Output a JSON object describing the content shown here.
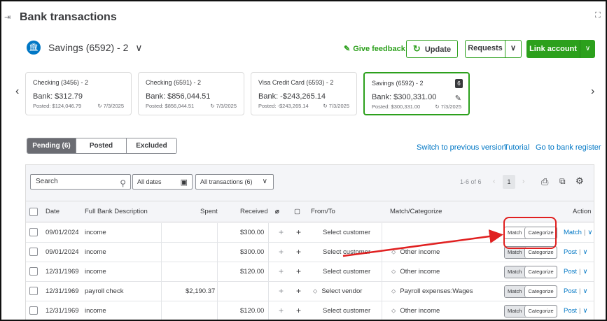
{
  "page": {
    "title": "Bank transactions"
  },
  "account": {
    "title": "Savings (6592) - 2",
    "chevron": "∨"
  },
  "header_actions": {
    "feedback_label": "Give feedback",
    "update_label": "Update",
    "requests_label": "Requests",
    "link_account_label": "Link account"
  },
  "cards": [
    {
      "name": "Checking (3456) - 2",
      "bank": "Bank: $312.79",
      "posted": "Posted: $124,046.79",
      "date": "7/3/2025",
      "selected": false
    },
    {
      "name": "Checking (6591) - 2",
      "bank": "Bank: $856,044.51",
      "posted": "Posted: $856,044.51",
      "date": "7/3/2025",
      "selected": false
    },
    {
      "name": "Visa Credit Card (6593) - 2",
      "bank": "Bank: -$243,265.14",
      "posted": "Posted: -$243,265.14",
      "date": "7/3/2025",
      "selected": false
    },
    {
      "name": "Savings (6592) - 2",
      "bank": "Bank: $300,331.00",
      "posted": "Posted: $300,331.00",
      "date": "7/3/2025",
      "selected": true,
      "badge": "6"
    }
  ],
  "tabs": {
    "pending": "Pending (6)",
    "posted": "Posted",
    "excluded": "Excluded"
  },
  "links": {
    "switch": "Switch to previous version",
    "tutorial": "Tutorial",
    "register": "Go to bank register"
  },
  "filters": {
    "search_placeholder": "Search",
    "dates": "All dates",
    "transactions": "All transactions (6)"
  },
  "pager": {
    "range": "1-6 of 6",
    "page": "1"
  },
  "table": {
    "headers": {
      "date": "Date",
      "desc": "Full Bank Description",
      "spent": "Spent",
      "received": "Received",
      "from_to": "From/To",
      "match": "Match/Categorize",
      "action": "Action"
    },
    "rows": [
      {
        "date": "09/01/2024",
        "desc": "income",
        "spent": "",
        "received": "$300.00",
        "from_to": "Select customer",
        "match": "",
        "action": "Match"
      },
      {
        "date": "09/01/2024",
        "desc": "income",
        "spent": "",
        "received": "$300.00",
        "from_to": "Select customer",
        "match": "Other income",
        "action": "Post"
      },
      {
        "date": "12/31/1969",
        "desc": "income",
        "spent": "",
        "received": "$120.00",
        "from_to": "Select customer",
        "match": "Other income",
        "action": "Post"
      },
      {
        "date": "12/31/1969",
        "desc": "payroll check",
        "spent": "$2,190.37",
        "received": "",
        "from_to": "Select vendor",
        "match": "Payroll expenses:Wages",
        "action": "Post"
      },
      {
        "date": "12/31/1969",
        "desc": "income",
        "spent": "",
        "received": "$120.00",
        "from_to": "Select customer",
        "match": "Other income",
        "action": "Post"
      }
    ],
    "pill": {
      "match": "Match",
      "categorize": "Categorize"
    }
  },
  "colors": {
    "brand_green": "#2ca01c",
    "link_blue": "#0077c5",
    "annotation_red": "#e02020"
  }
}
